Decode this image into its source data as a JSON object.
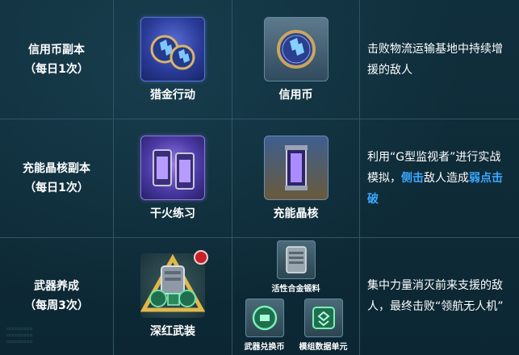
{
  "rows": [
    {
      "category": "信用币副本",
      "frequency": "（每日1次）",
      "stage": {
        "label": "猎金行动",
        "icon": "coins-icon"
      },
      "reward": {
        "label": "信用币",
        "icon": "credit-coin-icon"
      },
      "description": "击败物流运输基地中持续增援的敌人"
    },
    {
      "category": "充能晶核副本",
      "frequency": "（每日1次）",
      "stage": {
        "label": "干火练习",
        "icon": "energy-cores-icon"
      },
      "reward": {
        "label": "充能晶核",
        "icon": "energy-core-icon"
      },
      "description_parts": [
        "利用“G型监视者”进行实战模拟，",
        "侧击",
        "敌人造成",
        "弱点击破"
      ]
    },
    {
      "category": "武器养成",
      "frequency": "（每周3次）",
      "stage": {
        "label": "深红武装",
        "icon": "crimson-armament-icon"
      },
      "rewards": [
        {
          "label": "活性合金锻料",
          "icon": "alloy-canister-icon"
        },
        {
          "label": "武器兑换币",
          "icon": "weapon-token-icon"
        },
        {
          "label": "模组数据单元",
          "icon": "module-data-icon"
        }
      ],
      "description": "集中力量消灭前来支援的敌人，最终击败“领航无人机”"
    }
  ],
  "colors": {
    "highlight": "#3aa8ff",
    "grid_line": "#2f5566",
    "background": "#0d2a36"
  }
}
